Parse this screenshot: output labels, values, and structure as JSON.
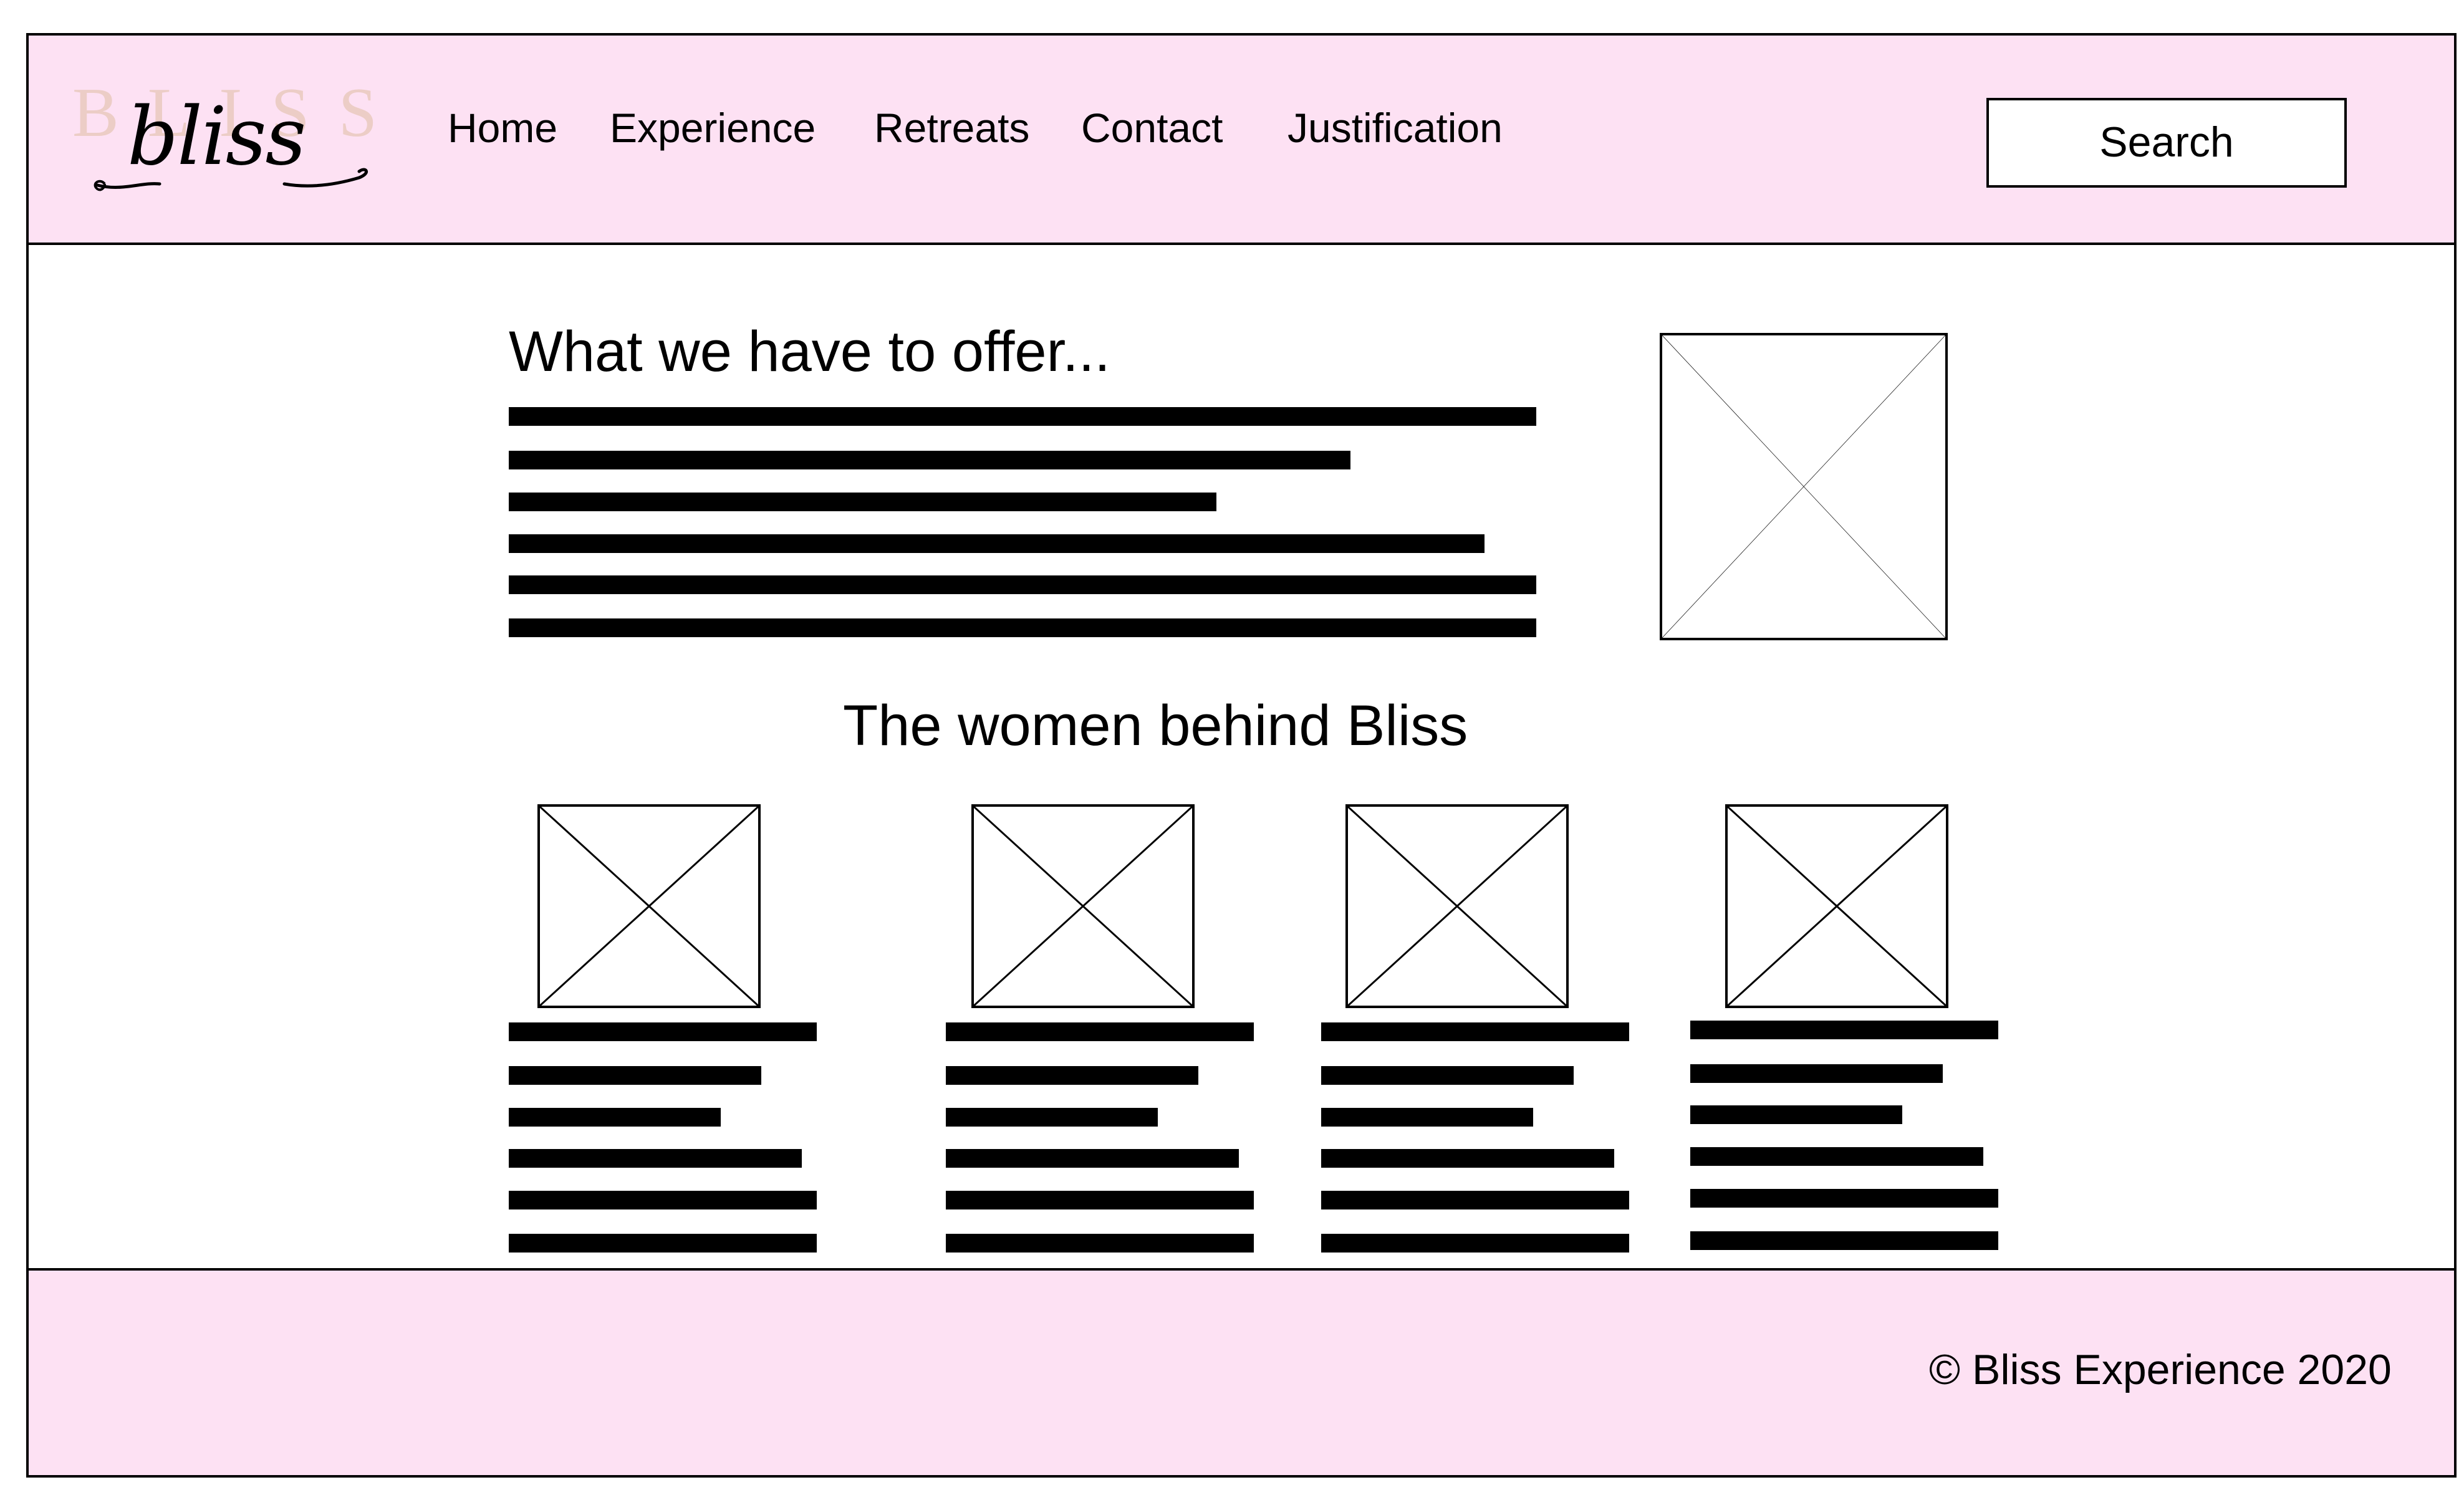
{
  "header": {
    "logo": {
      "letters": "BLISS",
      "script": "bliss"
    },
    "nav": [
      "Home",
      "Experience",
      "Retreats",
      "Contact",
      "Justification"
    ],
    "search_label": "Search"
  },
  "main": {
    "offer_heading": "What we have to offer...",
    "team_heading": "The women behind Bliss"
  },
  "footer": {
    "copyright": "© Bliss Experience 2020"
  },
  "colors": {
    "header_bg": "#fde1f3",
    "footer_bg": "#fde1f3",
    "logo_letters": "#eccdc6",
    "text": "#000000"
  }
}
